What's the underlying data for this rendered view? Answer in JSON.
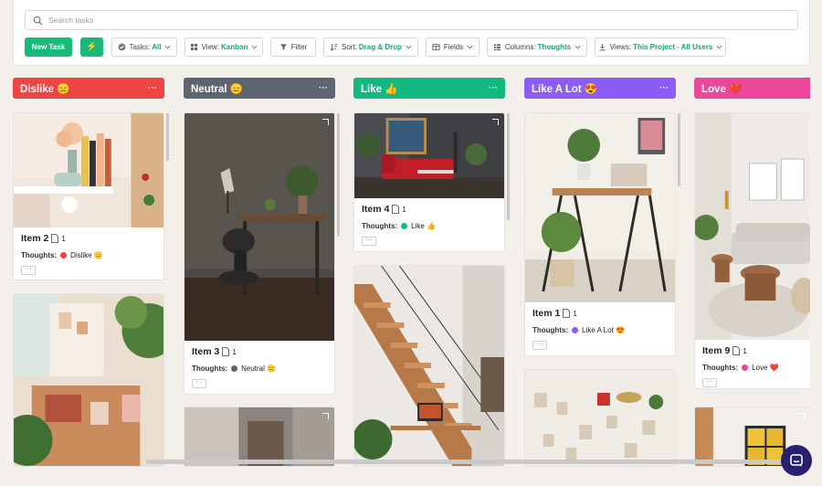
{
  "search": {
    "placeholder": "Search tasks"
  },
  "toolbar": {
    "new_task": "New Task",
    "bolt": "⚡",
    "tasks_label": "Tasks:",
    "tasks_value": "All",
    "view_label": "View:",
    "view_value": "Kanban",
    "filter_label": "Filter",
    "sort_label": "Sort:",
    "sort_value": "Drag & Drop",
    "fields_label": "Fields",
    "columns_label": "Columns:",
    "columns_value": "Thoughts",
    "views_label": "Views:",
    "views_value": "This Project - All Users"
  },
  "columns": [
    {
      "title": "Dislike 😑",
      "color": "#ef4444"
    },
    {
      "title": "Neutral 😑",
      "color": "#5e6570"
    },
    {
      "title": "Like 👍",
      "color": "#12b981"
    },
    {
      "title": "Like A Lot 😍",
      "color": "#8b5cf6"
    },
    {
      "title": "Love ❤️",
      "color": "#ec4899"
    }
  ],
  "cards": {
    "item2": {
      "title": "Item 2",
      "count": "1",
      "thoughts_label": "Thoughts:",
      "thought": "Dislike 😑",
      "more": "···"
    },
    "item3": {
      "title": "Item 3",
      "count": "1",
      "thoughts_label": "Thoughts:",
      "thought": "Neutral 😑",
      "more": "···"
    },
    "item4": {
      "title": "Item 4",
      "count": "1",
      "thoughts_label": "Thoughts:",
      "thought": "Like 👍",
      "more": "···"
    },
    "item1": {
      "title": "Item 1",
      "count": "1",
      "thoughts_label": "Thoughts:",
      "thought": "Like A Lot 😍",
      "more": "···"
    },
    "item9": {
      "title": "Item 9",
      "count": "1",
      "thoughts_label": "Thoughts:",
      "thought": "Love ❤️",
      "more": "···"
    }
  },
  "column_menu": "···",
  "colors": {
    "accent": "#19b97a",
    "dislike": "#ef4444",
    "neutral": "#5e6570",
    "like": "#12b981",
    "like_a_lot": "#8b5cf6",
    "love": "#ec4899"
  }
}
